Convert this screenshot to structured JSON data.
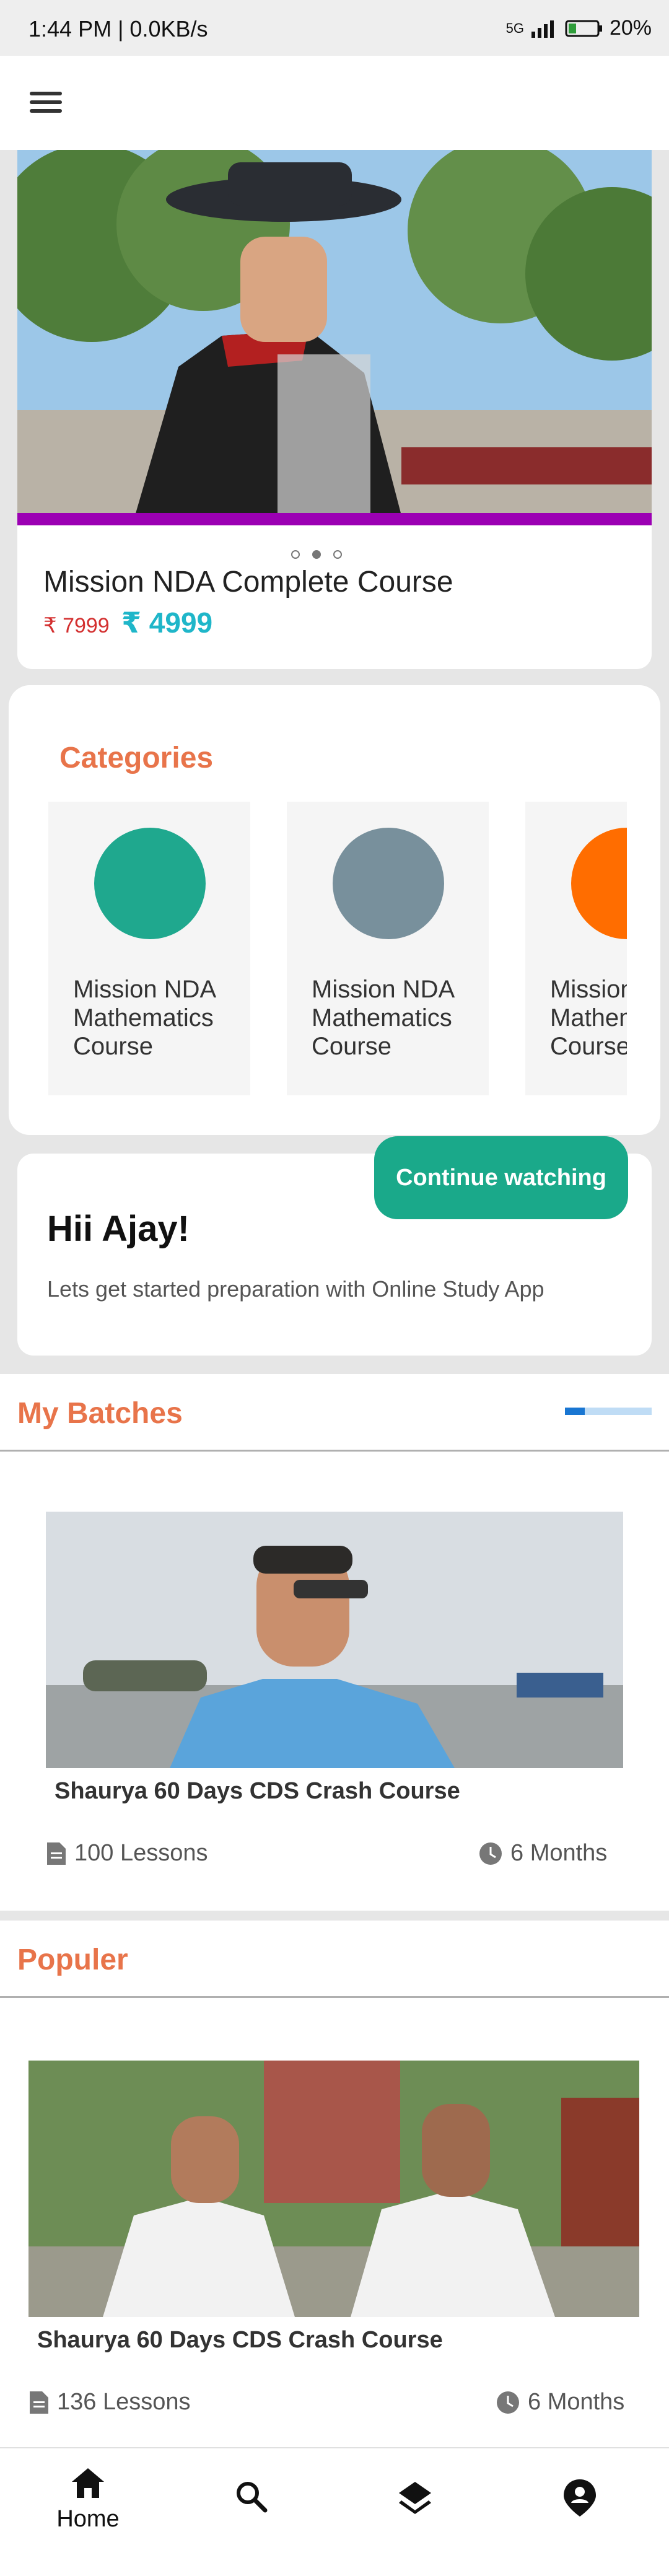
{
  "status_bar": {
    "time_speed": "1:44 PM | 0.0KB/s",
    "network": "5G",
    "battery": "20%"
  },
  "hero": {
    "title": "Mission NDA Complete Course",
    "old_price": "₹ 7999",
    "new_price": "₹ 4999",
    "accent_color": "#9b00b3",
    "slide_count": 3,
    "active_slide": 2
  },
  "categories": {
    "title": "Categories",
    "items": [
      {
        "label": "Mission NDA Mathematics Course",
        "color": "#1fa88e"
      },
      {
        "label": "Mission NDA Mathematics Course",
        "color": "#78909c"
      },
      {
        "label": "Mission NDA Mathematics Course",
        "color": "#ff6d00"
      }
    ]
  },
  "greeting": {
    "continue_label": "Continue watching",
    "title": "Hii Ajay!",
    "subtitle": "Lets get started preparation with Online Study App"
  },
  "my_batches": {
    "title": "My Batches",
    "course": {
      "title": "Shaurya 60 Days CDS Crash Course",
      "lessons": "100 Lessons",
      "duration": "6 Months"
    }
  },
  "popular": {
    "title": "Populer",
    "course": {
      "title": "Shaurya 60 Days CDS Crash Course",
      "lessons": "136 Lessons",
      "duration": "6 Months"
    }
  },
  "bottom_nav": {
    "home_label": "Home",
    "icons": [
      "home-icon",
      "search-icon",
      "layers-icon",
      "account-icon"
    ]
  }
}
